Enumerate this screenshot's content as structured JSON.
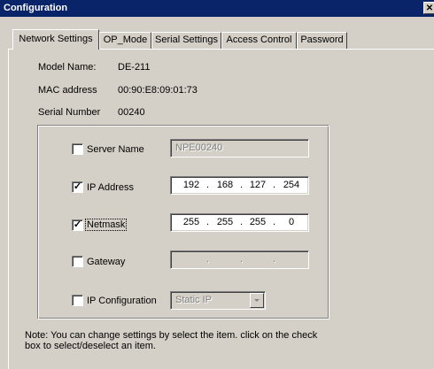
{
  "window": {
    "title": "Configuration",
    "close_glyph": "✕"
  },
  "tabs": [
    {
      "label": "Network Settings",
      "active": true
    },
    {
      "label": "OP_Mode"
    },
    {
      "label": "Serial Settings"
    },
    {
      "label": "Access Control"
    },
    {
      "label": "Password"
    }
  ],
  "info": {
    "model_label": "Model Name:",
    "model_value": "DE-211",
    "mac_label": "MAC address",
    "mac_value": "00:90:E8:09:01:73",
    "serial_label": "Serial Number",
    "serial_value": "00240"
  },
  "settings": {
    "server_name": {
      "label": "Server Name",
      "checked": false,
      "value": "NPE00240",
      "enabled": false
    },
    "ip_address": {
      "label": "IP Address",
      "checked": true,
      "octets": [
        "192",
        "168",
        "127",
        "254"
      ],
      "enabled": true
    },
    "netmask": {
      "label": "Netmask",
      "checked": true,
      "focused": true,
      "octets": [
        "255",
        "255",
        "255",
        "0"
      ],
      "enabled": true
    },
    "gateway": {
      "label": "Gateway",
      "checked": false,
      "octets": [
        "",
        "",
        "",
        ""
      ],
      "enabled": false
    },
    "ip_configuration": {
      "label": "IP Configuration",
      "checked": false,
      "value": "Static IP",
      "enabled": false
    }
  },
  "ip_separator": ".",
  "note": "Note: You can change settings by select the item. click on the check box to select/deselect an item.",
  "colors": {
    "titlebar": "#0a246a",
    "face": "#d4d0c8",
    "shadow": "#808080",
    "highlight": "#ffffff"
  }
}
